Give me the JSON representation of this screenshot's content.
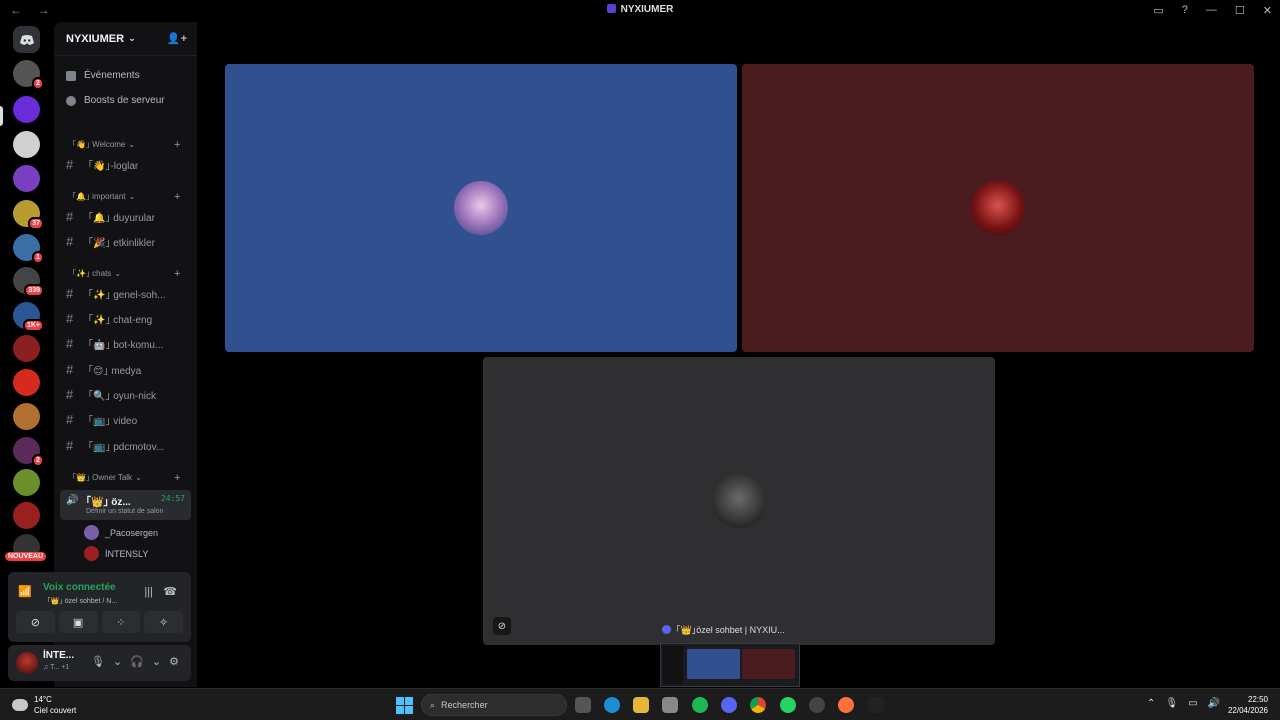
{
  "window": {
    "title": "NYXIUMER",
    "nav": "← →",
    "controls": [
      "▭",
      "?",
      "—",
      "☐",
      "✕"
    ]
  },
  "rail": {
    "home_icon": "discord-icon",
    "servers": [
      {
        "badge": "2",
        "color": "#555"
      },
      {
        "badge": "",
        "color": "#6a2bd9"
      },
      {
        "badge": "",
        "color": "#d0d0d0"
      },
      {
        "badge": "",
        "color": "#7a3fbf"
      },
      {
        "badge": "37",
        "color": "#b89b30"
      },
      {
        "badge": "1",
        "color": "#3a6ea5"
      },
      {
        "badge": "339",
        "color": "#444"
      },
      {
        "badge": "1K+",
        "color": "#2b5797"
      },
      {
        "badge": "",
        "color": "#8a2020"
      },
      {
        "badge": "",
        "color": "#d42b1e"
      },
      {
        "badge": "",
        "color": "#b07030"
      },
      {
        "badge": "2",
        "color": "#5a2a5a"
      },
      {
        "badge": "",
        "color": "#6b8f2a"
      },
      {
        "badge": "",
        "color": "#9a2020"
      },
      {
        "badge": "",
        "color": "#333"
      }
    ],
    "new_badge": "NOUVEAU"
  },
  "sidebar": {
    "server_name": "NYXIUMER",
    "menu": [
      {
        "label": "Événements",
        "icon": "calendar-icon"
      },
      {
        "label": "Boosts de serveur",
        "icon": "boost-icon"
      }
    ],
    "categories": [
      {
        "label": "｢👋｣ Welcome",
        "channels": [
          "｢👋｣-loglar"
        ]
      },
      {
        "label": "｢🔔｣ important",
        "channels": [
          "｢🔔｣ duyurular",
          "｢🎉｣ etkinlikler"
        ]
      },
      {
        "label": "｢✨｣ chats",
        "channels": [
          "｢✨｣ genel-soh...",
          "｢✨｣ chat-eng",
          "｢🤖｣ bot-komu...",
          "｢😊｣ medya",
          "｢🔍｣ oyun-nick",
          "｢📺｣ video",
          "｢📺｣ pdcmotov..."
        ]
      },
      {
        "label": "｢👑｣ Owner Talk",
        "channels": []
      }
    ],
    "voice_channel": {
      "name": "｢👑｣ öz...",
      "time": "24:57",
      "status": "Définir un statut de salon"
    },
    "voice_users": [
      "_Pacosergen",
      "İNTENSLY"
    ]
  },
  "voice_panel": {
    "status": "Voix connectée",
    "channel": "｢👑｣ özel sohbet / N..."
  },
  "user_panel": {
    "name": "İNTE...",
    "status": "♫ T... +1"
  },
  "stream": {
    "label": "｢👑｣özel sohbet | NYXIU..."
  },
  "taskbar": {
    "temp": "14°C",
    "weather": "Ciel couvert",
    "search_placeholder": "Rechercher",
    "time": "22:50",
    "date": "22/04/2026"
  }
}
